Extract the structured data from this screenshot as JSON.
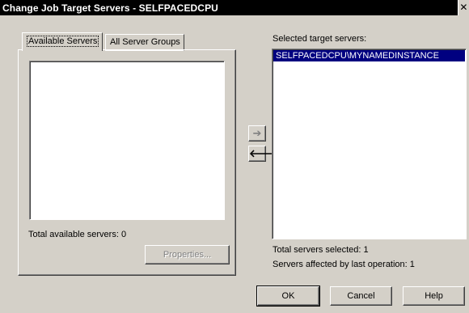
{
  "window": {
    "title": "Change Job Target Servers - SELFPACEDCPU",
    "close_glyph": "✕"
  },
  "tabs": [
    {
      "label": "Available Servers",
      "active": true
    },
    {
      "label": "All Server Groups",
      "active": false
    }
  ],
  "available": {
    "items": [],
    "total_label": "Total available servers: 0",
    "properties_label": "Properties..."
  },
  "transfer": {
    "add_icon": "arrow-right-icon",
    "remove_icon": "arrow-left-icon"
  },
  "selected": {
    "heading": "Selected target servers:",
    "items": [
      "SELFPACEDCPU\\MYNAMEDINSTANCE"
    ],
    "total_label": "Total servers selected: 1",
    "affected_label": "Servers affected by last operation: 1"
  },
  "buttons": {
    "ok": "OK",
    "cancel": "Cancel",
    "help": "Help"
  }
}
